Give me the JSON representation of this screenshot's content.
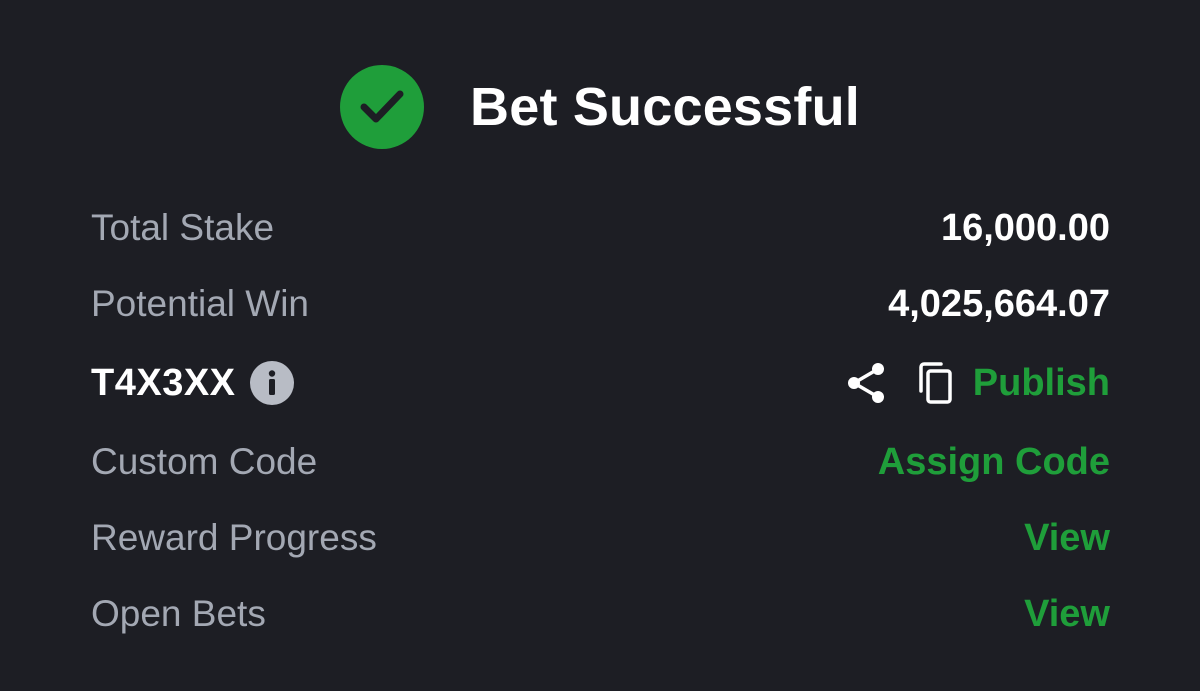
{
  "header": {
    "icon": "check-circle-icon",
    "title": "Bet Successful",
    "accent_color": "#1f9e3a"
  },
  "summary": {
    "total_stake_label": "Total Stake",
    "total_stake_value": "16,000.00",
    "potential_win_label": "Potential Win",
    "potential_win_value": "4,025,664.07"
  },
  "booking": {
    "code": "T4X3XX",
    "info_icon": "info-icon",
    "share_icon": "share-icon",
    "copy_icon": "copy-icon",
    "publish_label": "Publish"
  },
  "actions": {
    "custom_code_label": "Custom Code",
    "custom_code_action": "Assign Code",
    "reward_progress_label": "Reward Progress",
    "reward_progress_action": "View",
    "open_bets_label": "Open Bets",
    "open_bets_action": "View"
  }
}
